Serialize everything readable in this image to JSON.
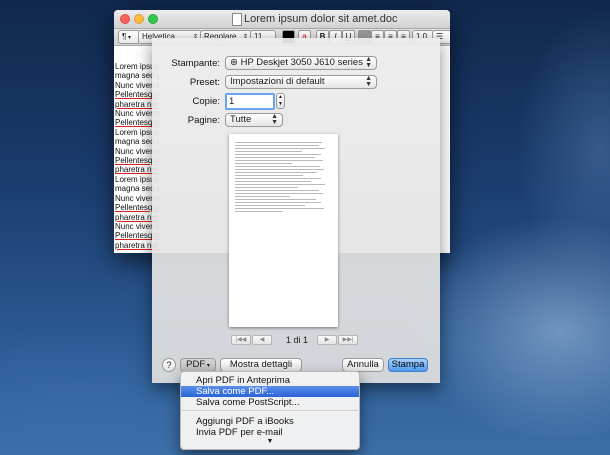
{
  "document_window": {
    "title": "Lorem ipsum dolor sit amet.doc",
    "toolbar": {
      "paragraph_style": "¶",
      "font_family": "Helvetica",
      "font_style": "Regolare",
      "font_size": "11",
      "bold": "B",
      "italic": "I",
      "underline": "U",
      "line_spacing": "1,0",
      "list": "☰"
    },
    "text_lines": [
      {
        "text": "Lorem ipsum",
        "flagged": false
      },
      {
        "text": "magna sed p",
        "flagged": false
      },
      {
        "text": "Nunc viverra",
        "flagged": false
      },
      {
        "text": "Pellentesque",
        "flagged": true
      },
      {
        "text": "pharetra non",
        "flagged": true
      },
      {
        "text": "Nunc viverra",
        "flagged": false
      },
      {
        "text": "Pellentesque",
        "flagged": true
      },
      {
        "text": "Lorem ipsum",
        "flagged": false
      },
      {
        "text": "magna sed p",
        "flagged": false
      },
      {
        "text": "Nunc viverra",
        "flagged": false
      },
      {
        "text": "Pellentesque",
        "flagged": true
      },
      {
        "text": "pharetra non",
        "flagged": true
      },
      {
        "text": "Lorem ipsum",
        "flagged": false
      },
      {
        "text": "magna sed p",
        "flagged": false
      },
      {
        "text": "Nunc viverra",
        "flagged": false
      },
      {
        "text": "Pellentesque",
        "flagged": true
      },
      {
        "text": "pharetra non",
        "flagged": true
      },
      {
        "text": "Nunc viverra",
        "flagged": false
      },
      {
        "text": "Pellentesque",
        "flagged": true
      },
      {
        "text": "pharetra non",
        "flagged": true
      }
    ]
  },
  "print_dialog": {
    "printer_label": "Stampante:",
    "printer_value": "HP Deskjet 3050 J610 series",
    "preset_label": "Preset:",
    "preset_value": "Impostazioni di default",
    "copies_label": "Copie:",
    "copies_value": "1",
    "pages_label": "Pagine:",
    "pages_value": "Tutte",
    "page_indicator": "1 di 1",
    "help": "?",
    "pdf_button": "PDF",
    "details_button": "Mostra dettagli",
    "cancel_button": "Annulla",
    "print_button": "Stampa"
  },
  "pdf_menu": {
    "items": [
      {
        "label": "Apri PDF in Anteprima",
        "highlighted": false
      },
      {
        "label": "Salva come PDF...",
        "highlighted": true
      },
      {
        "label": "Salva come PostScript...",
        "highlighted": false
      },
      {
        "label": "Aggiungi PDF a iBooks",
        "highlighted": false
      },
      {
        "label": "Invia PDF per e-mail",
        "highlighted": false
      }
    ],
    "more_indicator": "▼"
  },
  "colors": {
    "highlight": "#2a63d6",
    "default_button": "#4c9aee",
    "spelling_underline": "#e02020"
  }
}
